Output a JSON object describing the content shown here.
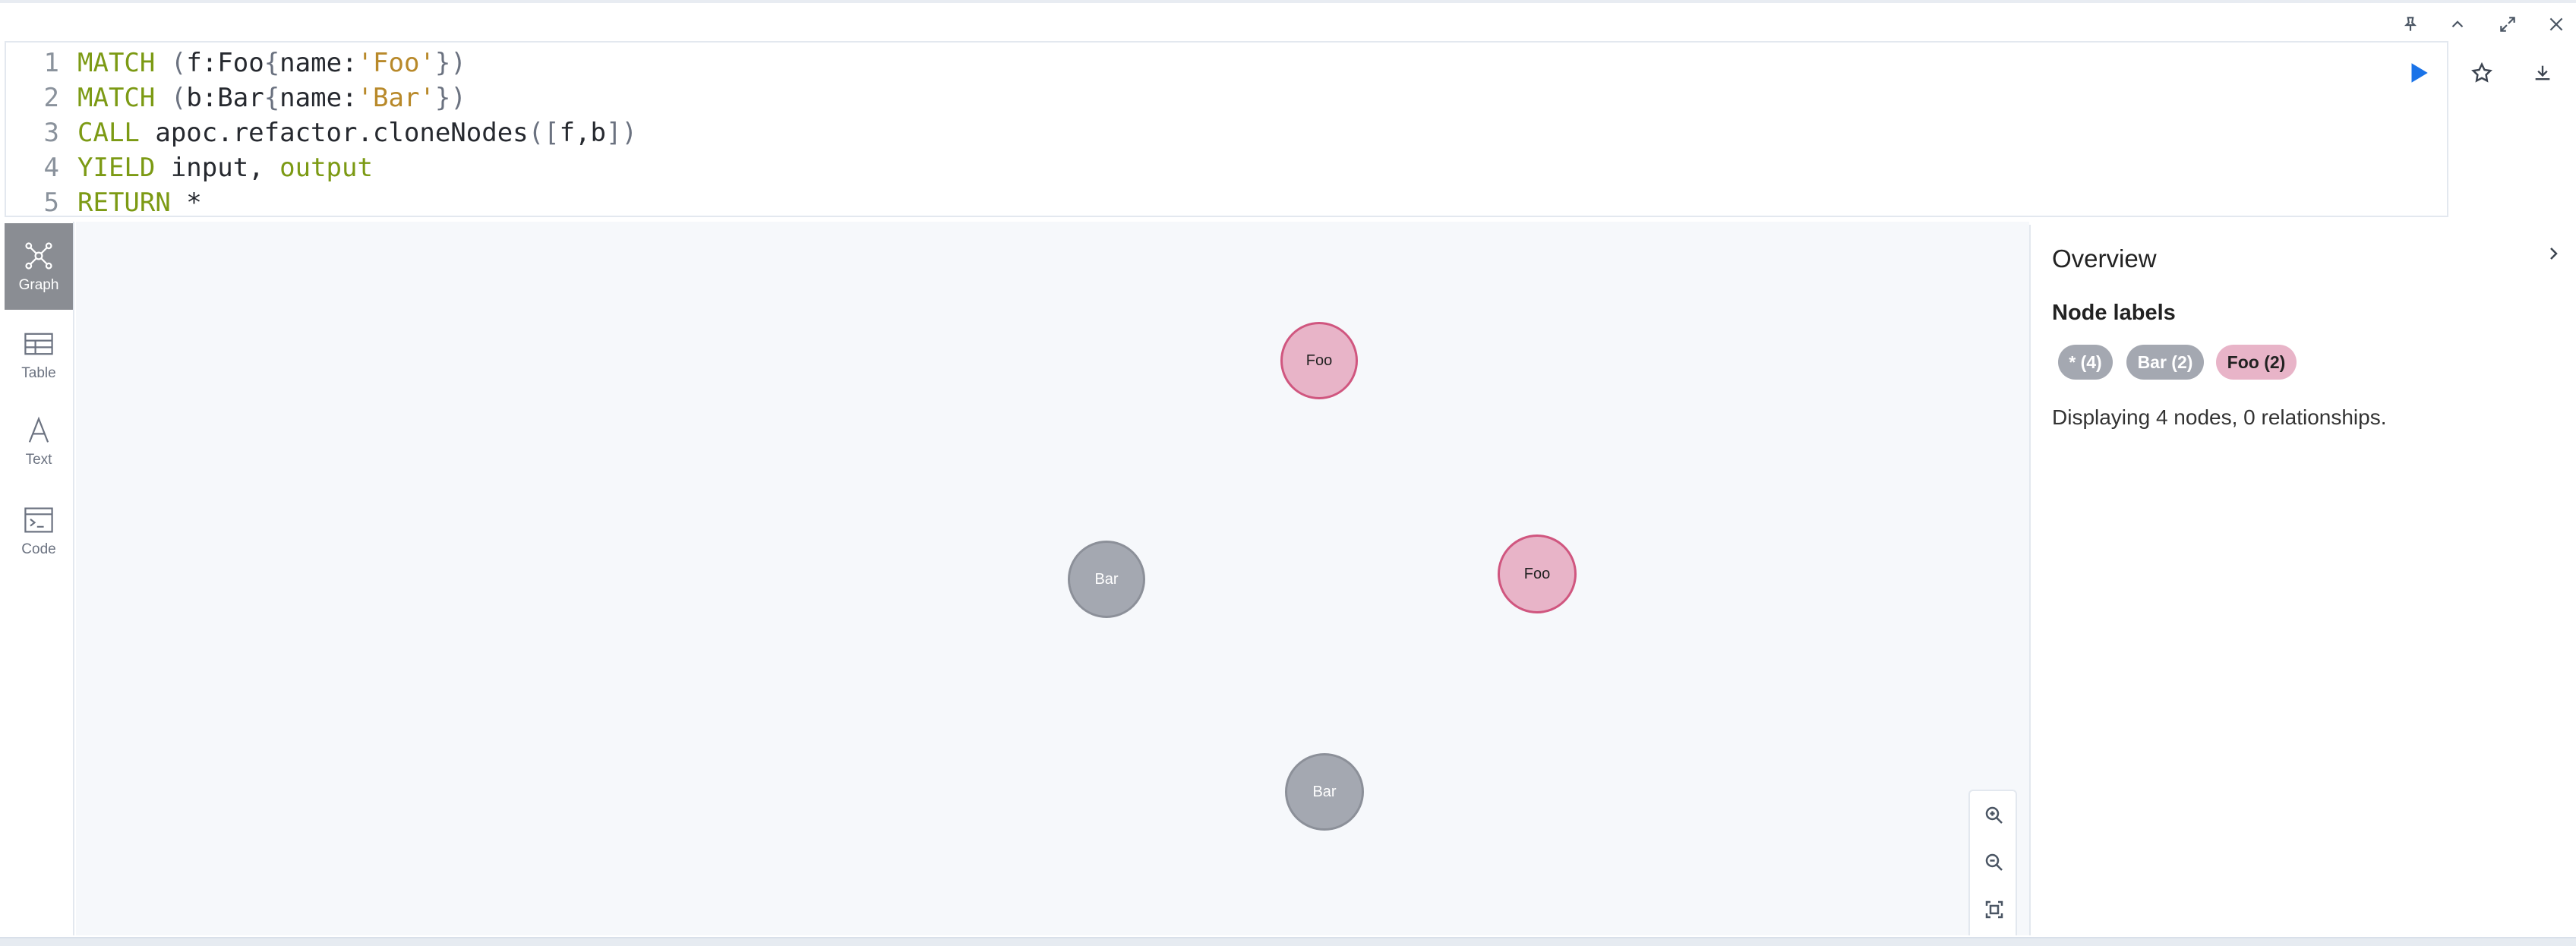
{
  "editor": {
    "lines": [
      {
        "n": "1",
        "tokens": [
          [
            "kw",
            "MATCH"
          ],
          [
            "pl",
            " "
          ],
          [
            "pu",
            "("
          ],
          [
            "pl",
            "f:Foo"
          ],
          [
            "pu",
            "{"
          ],
          [
            "pl",
            "name:"
          ],
          [
            "str",
            "'Foo'"
          ],
          [
            "pu",
            "})"
          ]
        ]
      },
      {
        "n": "2",
        "tokens": [
          [
            "kw",
            "MATCH"
          ],
          [
            "pl",
            " "
          ],
          [
            "pu",
            "("
          ],
          [
            "pl",
            "b:Bar"
          ],
          [
            "pu",
            "{"
          ],
          [
            "pl",
            "name:"
          ],
          [
            "str",
            "'Bar'"
          ],
          [
            "pu",
            "})"
          ]
        ]
      },
      {
        "n": "3",
        "tokens": [
          [
            "kw",
            "CALL"
          ],
          [
            "pl",
            " apoc.refactor.cloneNodes"
          ],
          [
            "pu",
            "(["
          ],
          [
            "pl",
            "f,b"
          ],
          [
            "pu",
            "])"
          ]
        ]
      },
      {
        "n": "4",
        "tokens": [
          [
            "kw",
            "YIELD"
          ],
          [
            "pl",
            " input, "
          ],
          [
            "kw",
            "output"
          ]
        ]
      },
      {
        "n": "5",
        "tokens": [
          [
            "kw",
            "RETURN"
          ],
          [
            "pl",
            " *"
          ]
        ]
      }
    ]
  },
  "tabs": [
    {
      "id": "graph",
      "label": "Graph",
      "active": true
    },
    {
      "id": "table",
      "label": "Table",
      "active": false
    },
    {
      "id": "text",
      "label": "Text",
      "active": false
    },
    {
      "id": "code",
      "label": "Code",
      "active": false
    }
  ],
  "graph": {
    "nodes": [
      {
        "label": "Foo",
        "type": "foo"
      },
      {
        "label": "Bar",
        "type": "bar"
      },
      {
        "label": "Foo",
        "type": "foo"
      },
      {
        "label": "Bar",
        "type": "bar"
      }
    ]
  },
  "overview": {
    "title": "Overview",
    "node_labels_heading": "Node labels",
    "pills": [
      {
        "label": "* (4)"
      },
      {
        "label": "Bar (2)"
      },
      {
        "label": "Foo (2)"
      }
    ],
    "description": "Displaying 4 nodes, 0 relationships."
  },
  "colors": {
    "foo_fill": "#e8b4c8",
    "foo_border": "#d0567f",
    "bar_fill": "#a4a8b1",
    "run_button": "#1a73e8"
  },
  "icons": {
    "header": [
      "pin-icon",
      "collapse-up-icon",
      "expand-icon",
      "close-icon"
    ],
    "editor": [
      "run-icon",
      "star-icon",
      "download-icon"
    ],
    "zoom": [
      "zoom-in-icon",
      "zoom-out-icon",
      "fit-to-screen-icon"
    ]
  }
}
